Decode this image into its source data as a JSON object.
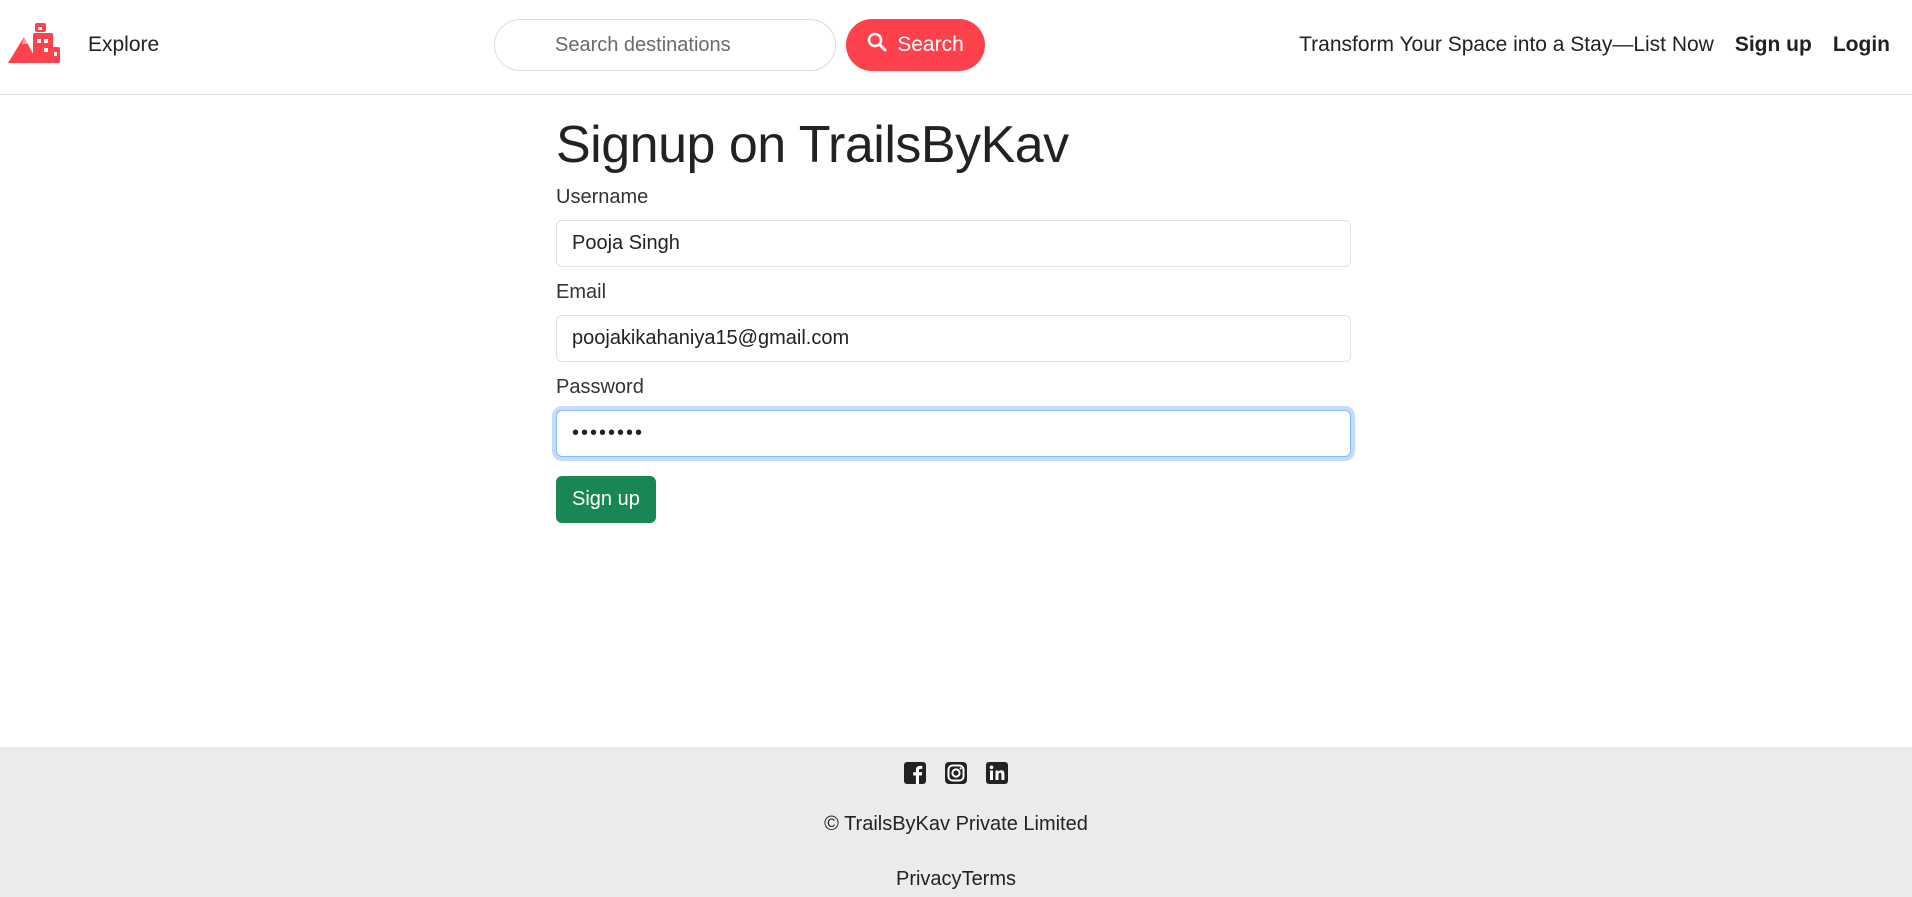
{
  "navbar": {
    "logo_icon": "mountain-hotel-logo-icon",
    "explore_label": "Explore",
    "search": {
      "placeholder": "Search destinations",
      "value": "",
      "button_label": "Search",
      "button_icon": "search-icon"
    },
    "host_link": "Transform Your Space into a Stay—List Now",
    "signup_link": "Sign up",
    "login_link": "Login"
  },
  "form": {
    "title": "Signup on TrailsByKav",
    "username_label": "Username",
    "username_value": "Pooja Singh",
    "email_label": "Email",
    "email_value": "poojakikahaniya15@gmail.com",
    "password_label": "Password",
    "password_value": "••••••••",
    "submit_label": "Sign up"
  },
  "footer": {
    "social_icons": [
      "facebook-icon",
      "instagram-icon",
      "linkedin-icon"
    ],
    "copyright": "© TrailsByKav Private Limited",
    "privacy_link": "Privacy",
    "terms_link": "Terms"
  },
  "colors": {
    "brand": "#fe424d",
    "submit": "#198754",
    "footer_bg": "#ebebeb",
    "focus_border": "#86b7fe"
  }
}
